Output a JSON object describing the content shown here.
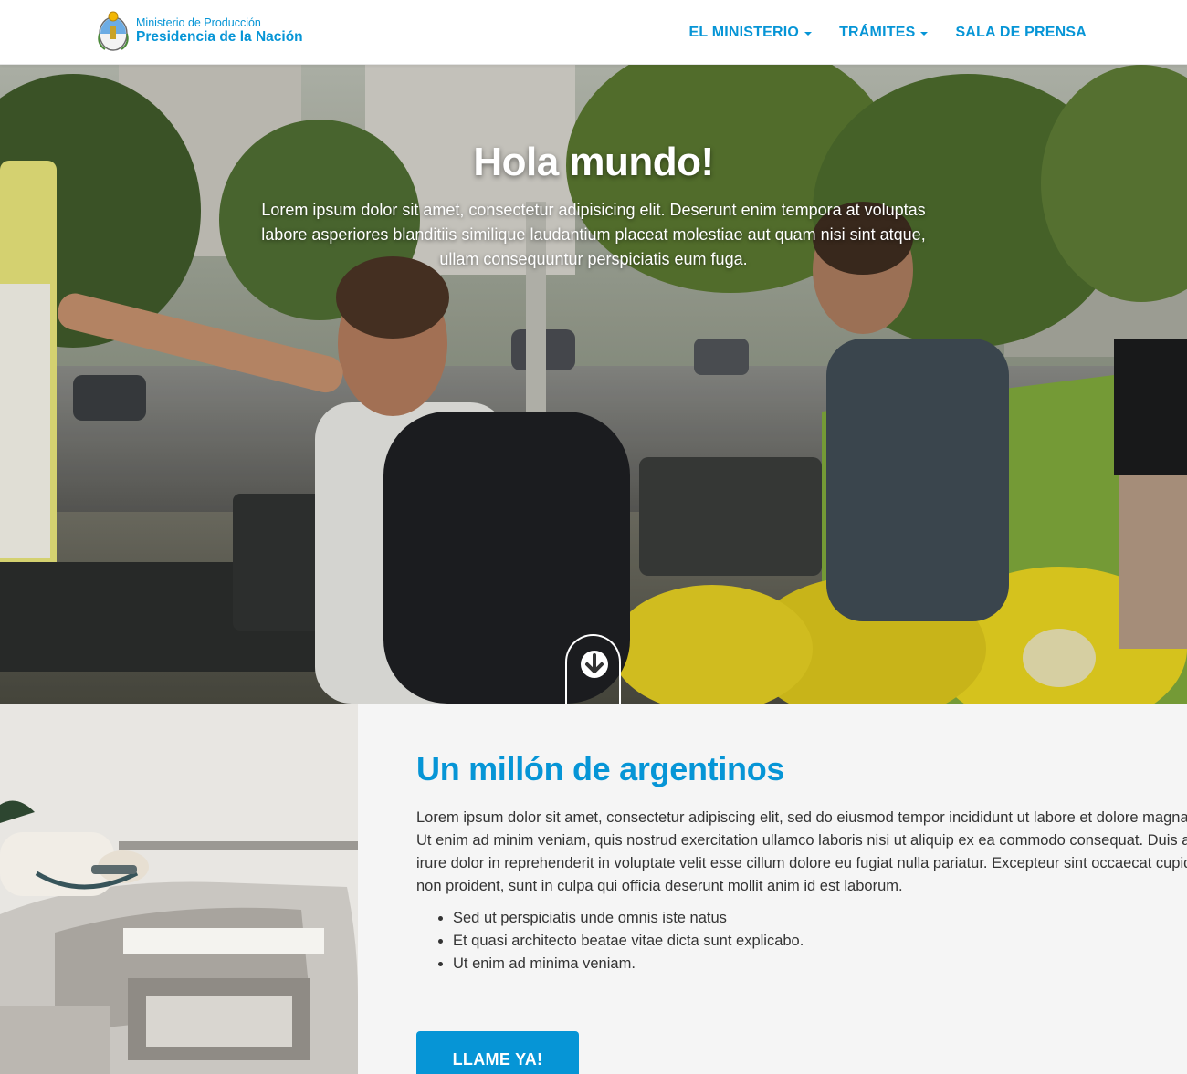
{
  "header": {
    "brand_line1": "Ministerio de Producción",
    "brand_line2": "Presidencia de la Nación",
    "nav": [
      {
        "label": "EL MINISTERIO"
      },
      {
        "label": "TRÁMITES"
      },
      {
        "label": "SALA DE PRENSA"
      }
    ]
  },
  "hero": {
    "title": "Hola mundo!",
    "lead": "Lorem ipsum dolor sit amet, consectetur adipisicing elit. Deserunt enim tempora at voluptas labore asperiores blanditiis similique laudantium placeat molestiae aut quam nisi sint atque, ullam consequuntur perspiciatis eum fuga.",
    "scroll_icon": "arrow-down-icon"
  },
  "section": {
    "title": "Un millón de argentinos",
    "text": "Lorem ipsum dolor sit amet, consectetur adipiscing elit, sed do eiusmod tempor incididunt ut labore et dolore magna aliqua. Ut enim ad minim veniam, quis nostrud exercitation ullamco laboris nisi ut aliquip ex ea commodo consequat. Duis aute irure dolor in reprehenderit in voluptate velit esse cillum dolore eu fugiat nulla pariatur. Excepteur sint occaecat cupidatat non proident, sunt in culpa qui officia deserunt mollit anim id est laborum.",
    "list": [
      "Sed ut perspiciatis unde omnis iste natus",
      "Et quasi architecto beatae vitae dicta sunt explicabo.",
      "Ut enim ad minima veniam."
    ],
    "cta_label": "LLAME YA!"
  },
  "colors": {
    "accent": "#0695d6",
    "hero_text": "#ffffff",
    "section_bg": "#f5f5f5"
  }
}
